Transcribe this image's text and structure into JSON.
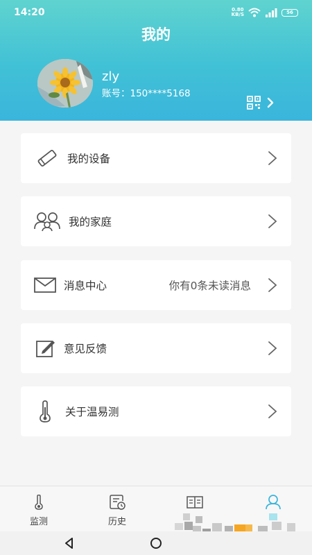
{
  "status_bar": {
    "time": "14:20",
    "net_speed_value": "0.80",
    "net_speed_unit": "KB/S",
    "battery": "56"
  },
  "header": {
    "title": "我的",
    "username": "zly",
    "account": "账号：150****5168"
  },
  "menu": [
    {
      "label": "我的设备",
      "icon": "device-icon"
    },
    {
      "label": "我的家庭",
      "icon": "family-icon"
    },
    {
      "label": "消息中心",
      "icon": "mail-icon",
      "extra": "你有0条未读消息"
    },
    {
      "label": "意见反馈",
      "icon": "edit-icon"
    },
    {
      "label": "关于温易测",
      "icon": "thermometer-icon"
    }
  ],
  "tabs": [
    {
      "label": "监测",
      "icon": "thermometer-tab-icon"
    },
    {
      "label": "历史",
      "icon": "history-icon"
    },
    {
      "label": "",
      "icon": "book-icon"
    },
    {
      "label": "",
      "icon": "user-icon",
      "active": true
    }
  ],
  "colors": {
    "header_top": "#5fd3cf",
    "header_bottom": "#3ab5dc",
    "active_tab": "#3ab5dc",
    "icon_gray": "#555555"
  }
}
